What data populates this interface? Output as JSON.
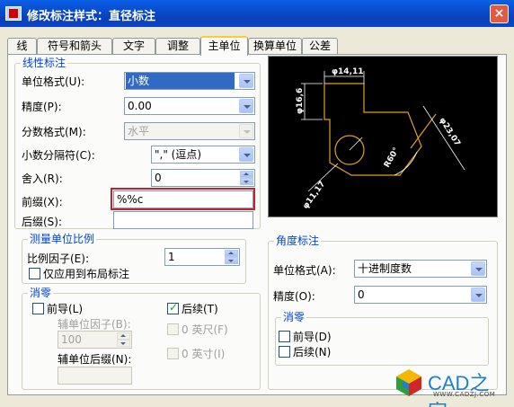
{
  "window": {
    "title": "修改标注样式：直径标注",
    "close": "×"
  },
  "tabs": [
    "线",
    "符号和箭头",
    "文字",
    "调整",
    "主单位",
    "换算单位",
    "公差"
  ],
  "linear": {
    "title": "线性标注",
    "unit_format_label": "单位格式(U):",
    "unit_format_value": "小数",
    "precision_label": "精度(P):",
    "precision_value": "0.00",
    "fraction_label": "分数格式(M):",
    "fraction_value": "水平",
    "decimal_sep_label": "小数分隔符(C):",
    "decimal_sep_value": "\",\" (逗点)",
    "round_label": "舍入(R):",
    "round_value": "0",
    "prefix_label": "前缀(X):",
    "prefix_value": "%%c",
    "suffix_label": "后缀(S):",
    "suffix_value": ""
  },
  "scale": {
    "title": "测量单位比例",
    "factor_label": "比例因子(E):",
    "factor_value": "1",
    "layout_label": "仅应用到布局标注"
  },
  "zero": {
    "title": "消零",
    "leading_label": "前导(L)",
    "trailing_label": "后续(T)",
    "sub_factor_label": "辅单位因子(B):",
    "sub_factor_value": "100",
    "sub_suffix_label": "辅单位后缀(N):",
    "sub_suffix_value": "",
    "feet_label": "0 英尺(F)",
    "inch_label": "0 英寸(I)"
  },
  "angular": {
    "title": "角度标注",
    "unit_format_label": "单位格式(A):",
    "unit_format_value": "十进制度数",
    "precision_label": "精度(O):",
    "precision_value": "0",
    "zero_title": "消零",
    "leading_label": "前导(D)",
    "trailing_label": "后续(N)"
  },
  "preview": {
    "dims": [
      "φ14,11",
      "φ16,6",
      "φ23,07",
      "φ11,17",
      "R60°"
    ]
  },
  "watermark": {
    "name": "CAD之家",
    "url": "WWW.CADZJ.COM"
  }
}
